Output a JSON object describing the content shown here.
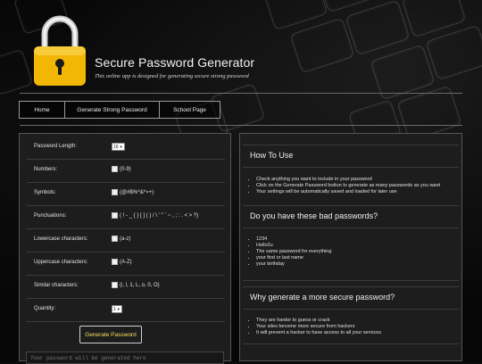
{
  "header": {
    "title": "Secure Password Generator",
    "subtitle": "This online app is designed for generating secure strong password"
  },
  "nav": [
    {
      "label": "Home"
    },
    {
      "label": "Generate Strong Password"
    },
    {
      "label": "School Page"
    }
  ],
  "form": {
    "length": {
      "label": "Password Length:",
      "value": "16"
    },
    "numbers": {
      "label": "Numbers:",
      "option": "(0-9)"
    },
    "symbols": {
      "label": "Symbols:",
      "option": "(@#$%^&*=+)"
    },
    "punctuations": {
      "label": "Punctuations:",
      "option": "( ! - _ { } [ ] ( ) / \\ ' \" ` ~ , ; : . < > ?)"
    },
    "lowercase": {
      "label": "Lowercase characters:",
      "option": "(a-z)"
    },
    "uppercase": {
      "label": "Uppercase characters:",
      "option": "(A-Z)"
    },
    "similar": {
      "label": "Similar characters:",
      "option": "(i, l, 1, L, o, 0, O)"
    },
    "quantity": {
      "label": "Quantity:",
      "value": "1"
    },
    "generate_label": "Generate Password",
    "output_placeholder": "Your password will be generated here"
  },
  "sidebar": {
    "how_to_use": {
      "heading": "How To Use",
      "items": [
        "Check anything you want to include in your password",
        "Click on the Generate Password button to generate as many passwords as you want",
        "Your settings will be automatically saved and loaded for later use"
      ]
    },
    "bad_passwords": {
      "heading": "Do you have these bad passwords?",
      "items": [
        "1234",
        "Hello2u",
        "The same password for everything",
        "your first or last name",
        "your birthday"
      ]
    },
    "why": {
      "heading": "Why generate a more secure password?",
      "items": [
        "They are harder to guess or crack",
        "Your sites become more secure from hackers",
        "It will prevent a hacker to have access to all your services"
      ]
    }
  },
  "colors": {
    "accent_yellow": "#f4e05a",
    "lock_body": "#f2b705",
    "panel_bg": "#1d1d1d"
  }
}
